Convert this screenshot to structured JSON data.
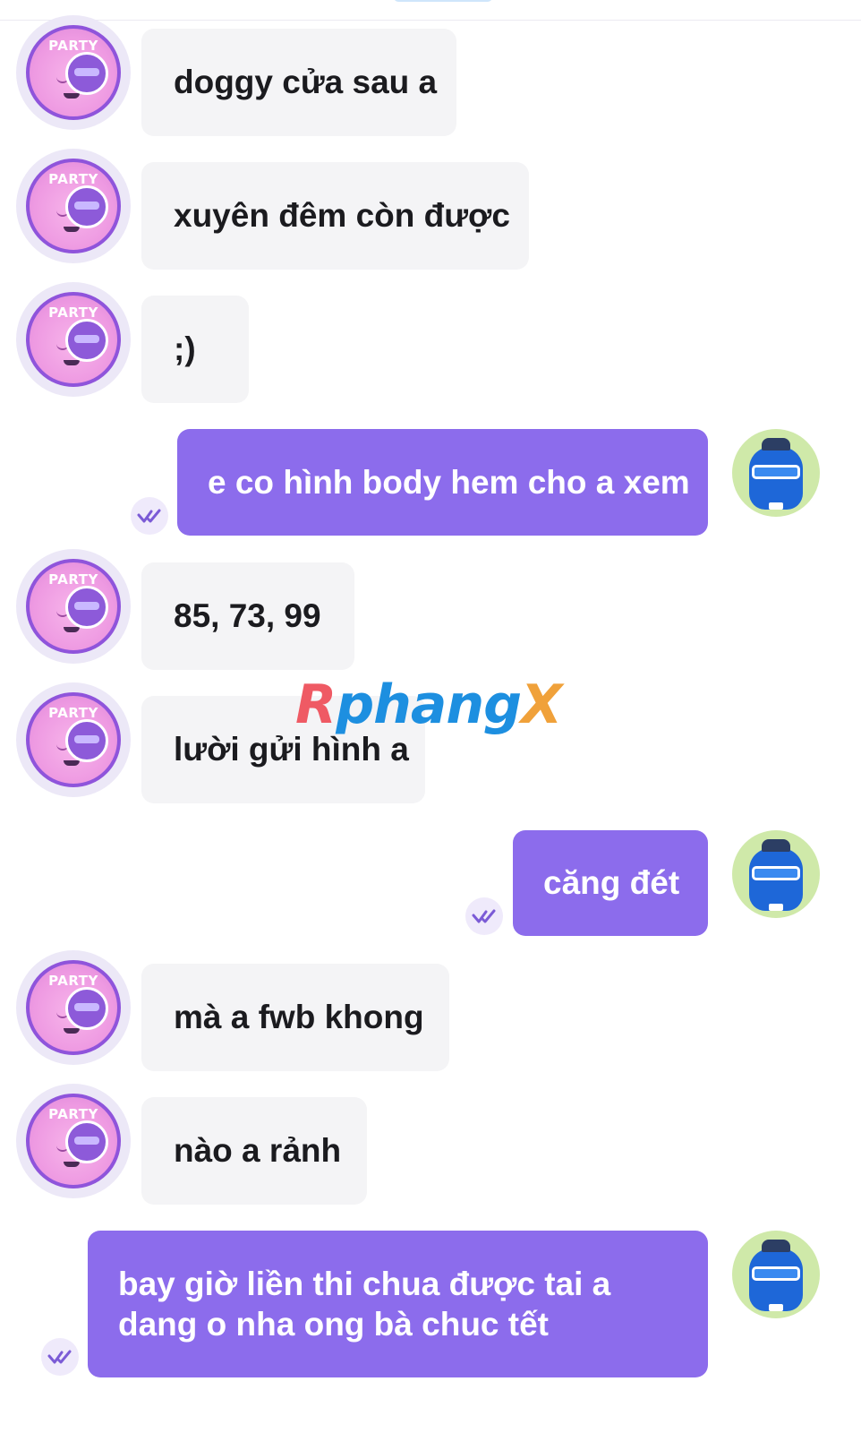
{
  "avatar_badge_text": "PARTY",
  "watermark": {
    "part1": "R",
    "part2": "phang",
    "part3": "X"
  },
  "messages": [
    {
      "side": "in",
      "text": "doggy cửa sau a"
    },
    {
      "side": "in",
      "text": "xuyên đêm còn được"
    },
    {
      "side": "in",
      "text": ";)"
    },
    {
      "side": "out",
      "text": "e co hình body hem cho a xem",
      "status": "read"
    },
    {
      "side": "in",
      "text": "85, 73, 99"
    },
    {
      "side": "in",
      "text": "lười gửi hình a"
    },
    {
      "side": "out",
      "text": "căng đét",
      "status": "read"
    },
    {
      "side": "in",
      "text": "mà a fwb khong"
    },
    {
      "side": "in",
      "text": "nào a rảnh"
    },
    {
      "side": "out",
      "text": "bay giờ liền thi  chua được tai a dang o nha ong bà chuc tết",
      "status": "read"
    }
  ],
  "colors": {
    "outgoing_bubble": "#8c6cec",
    "incoming_bubble": "#f4f4f6",
    "accent_purple": "#8f54db"
  }
}
